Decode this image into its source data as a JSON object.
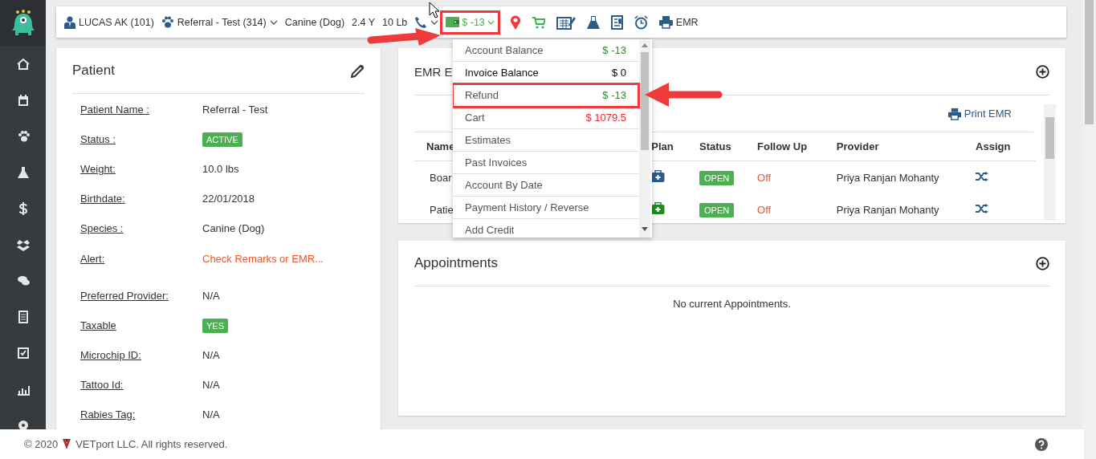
{
  "top_bar": {
    "client": "LUCAS AK (101)",
    "patient": "Referral - Test (314)",
    "species": "Canine (Dog)",
    "age": "2.4 Y",
    "weight": "10 Lb",
    "balance": {
      "text": "$ -13",
      "highlighted": true
    },
    "emr": "EMR"
  },
  "account_menu": {
    "items": [
      {
        "label": "Account Balance",
        "value": "$ -13",
        "color": "#2e8b2e",
        "highlighted": false
      },
      {
        "label": "Invoice Balance",
        "value": "$ 0",
        "color": "#000000",
        "highlighted": false
      },
      {
        "label": "Refund",
        "value": "$ -13",
        "color": "#2e8b2e",
        "highlighted": true
      },
      {
        "label": "Cart",
        "value": "$ 1079.5",
        "color": "#ff2020",
        "highlighted": false
      },
      {
        "label": "Estimates",
        "highlighted": false
      },
      {
        "label": "Past Invoices",
        "highlighted": false
      },
      {
        "label": "Account By Date",
        "highlighted": false
      },
      {
        "label": "Payment History / Reverse",
        "highlighted": false
      },
      {
        "label": "Add Credit",
        "highlighted": false
      }
    ]
  },
  "patient": {
    "title": "Patient",
    "fields": [
      {
        "label": "Patient Name :",
        "value": "Referral - Test",
        "kind": "text"
      },
      {
        "label": "Status :",
        "value": "ACTIVE",
        "kind": "badge"
      },
      {
        "label": "Weight:",
        "value": "10.0 lbs",
        "kind": "text"
      },
      {
        "label": "Birthdate:",
        "value": "22/01/2018",
        "kind": "text"
      },
      {
        "label": "Species :",
        "value": "Canine (Dog)",
        "kind": "text"
      },
      {
        "label": "Alert:",
        "value": "Check Remarks or EMR...",
        "kind": "alert"
      },
      {
        "label": "Preferred Provider:",
        "value": "N/A",
        "kind": "text"
      },
      {
        "label": "Taxable",
        "value": "YES",
        "kind": "badge"
      },
      {
        "label": "Microchip ID:",
        "value": "N/A",
        "kind": "text"
      },
      {
        "label": "Tattoo Id:",
        "value": "N/A",
        "kind": "text"
      },
      {
        "label": "Rabies Tag:",
        "value": "N/A",
        "kind": "text"
      }
    ]
  },
  "emr": {
    "title": "EMR E",
    "print": "Print EMR",
    "columns": [
      "Name",
      "Plan",
      "Status",
      "Follow Up",
      "Provider",
      "Assign"
    ],
    "rows": [
      {
        "name": "Boar",
        "color": "#2a5b8c",
        "status": "OPEN",
        "follow_up": "Off",
        "provider": "Priya Ranjan Mohanty"
      },
      {
        "name": "Patie",
        "color": "#1e8c1e",
        "status": "OPEN",
        "follow_up": "Off",
        "provider": "Priya Ranjan Mohanty"
      }
    ]
  },
  "appointments": {
    "title": "Appointments",
    "empty": "No current Appointments."
  },
  "footer": {
    "year": "© 2020",
    "company": "VETport LLC. All rights reserved."
  }
}
